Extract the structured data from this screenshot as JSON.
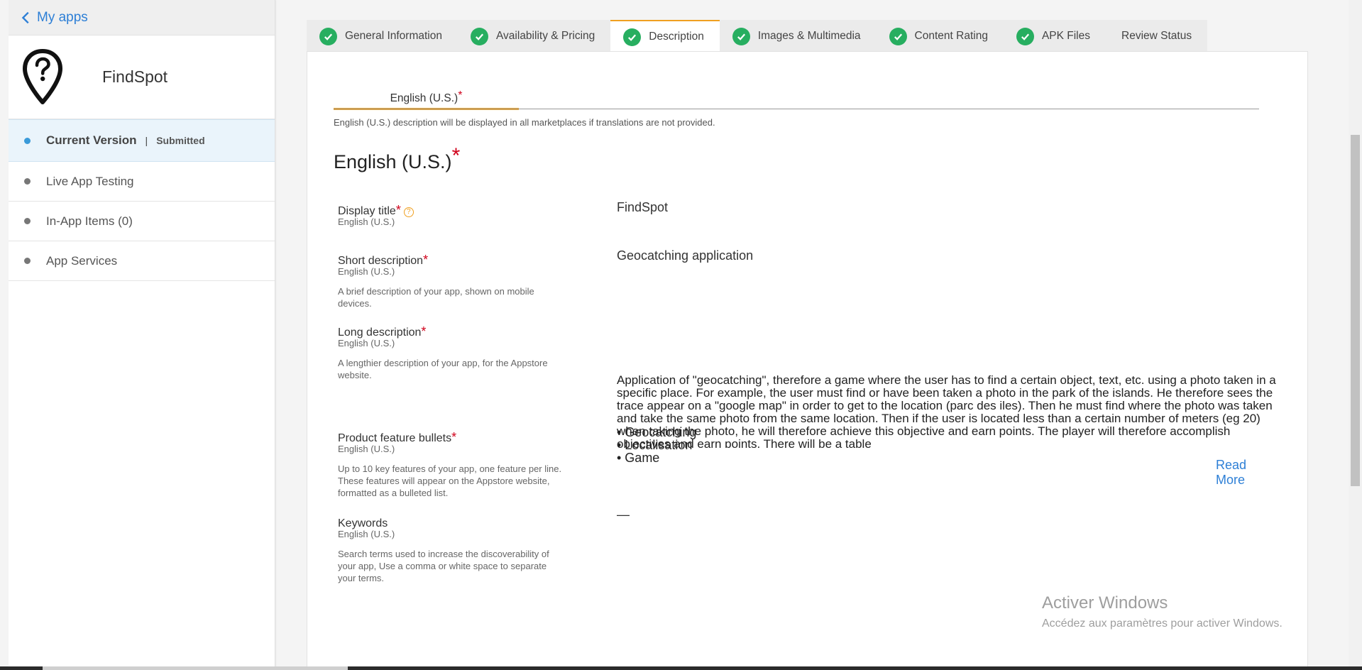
{
  "sidebar": {
    "back_label": "My apps",
    "app_name": "FindSpot",
    "items": [
      {
        "label": "Current Version",
        "separator": "|",
        "status": "Submitted"
      },
      {
        "label": "Live App Testing"
      },
      {
        "label": "In-App Items (0)"
      },
      {
        "label": "App Services"
      }
    ]
  },
  "tabs": [
    {
      "label": "General Information",
      "complete": true
    },
    {
      "label": "Availability & Pricing",
      "complete": true
    },
    {
      "label": "Description",
      "complete": true,
      "active": true
    },
    {
      "label": "Images & Multimedia",
      "complete": true
    },
    {
      "label": "Content Rating",
      "complete": true
    },
    {
      "label": "APK Files",
      "complete": true
    },
    {
      "label": "Review Status",
      "complete": false
    }
  ],
  "language": {
    "tab_label": "English (U.S.)",
    "required_mark": "*",
    "note": "English (U.S.) description will be displayed in all marketplaces if translations are not provided."
  },
  "section_title": "English (U.S.)",
  "fields": {
    "display_title": {
      "label": "Display title",
      "sub": "English (U.S.)",
      "value": "FindSpot"
    },
    "short_description": {
      "label": "Short description",
      "sub": "English (U.S.)",
      "help": "A brief description of your app, shown on mobile devices.",
      "value": "Geocatching application"
    },
    "long_description": {
      "label": "Long description",
      "sub": "English (U.S.)",
      "help": "A lengthier description of your app, for the Appstore website.",
      "value": "Application of \"geocatching\", therefore a game where the user has to find a certain object, text, etc. using a photo taken in a specific place. For example, the user must find or have been taken a photo in the park of the islands. He therefore sees the trace appear on a \"google map\" in order to get to the location (parc des iles). Then he must find where the photo was taken and take the same photo from the same location. Then if the user is located less than a certain number of meters (eg 20) when taking the photo, he will therefore achieve this objective and earn points. The player will therefore accomplish objectives and earn points. There will be a table",
      "read_more": "Read More"
    },
    "feature_bullets": {
      "label": "Product feature bullets",
      "sub": "English (U.S.)",
      "help": "Up to 10 key features of your app, one feature per line. These features will appear on the Appstore website, formatted as a bulleted list.",
      "values": [
        "• Geocatching",
        "• Localisation",
        "• Game"
      ]
    },
    "keywords": {
      "label": "Keywords",
      "sub": "English (U.S.)",
      "help": "Search terms used to increase the discoverability of your app, Use a comma or white space to separate your terms.",
      "value": "—"
    }
  },
  "watermark": {
    "line1": "Activer Windows",
    "line2": "Accédez aux paramètres pour activer Windows."
  },
  "colors": {
    "accent_blue": "#2d7fd6",
    "tab_active_border": "#f0a020",
    "check_green": "#27ae60",
    "required_red": "#d0021b"
  }
}
